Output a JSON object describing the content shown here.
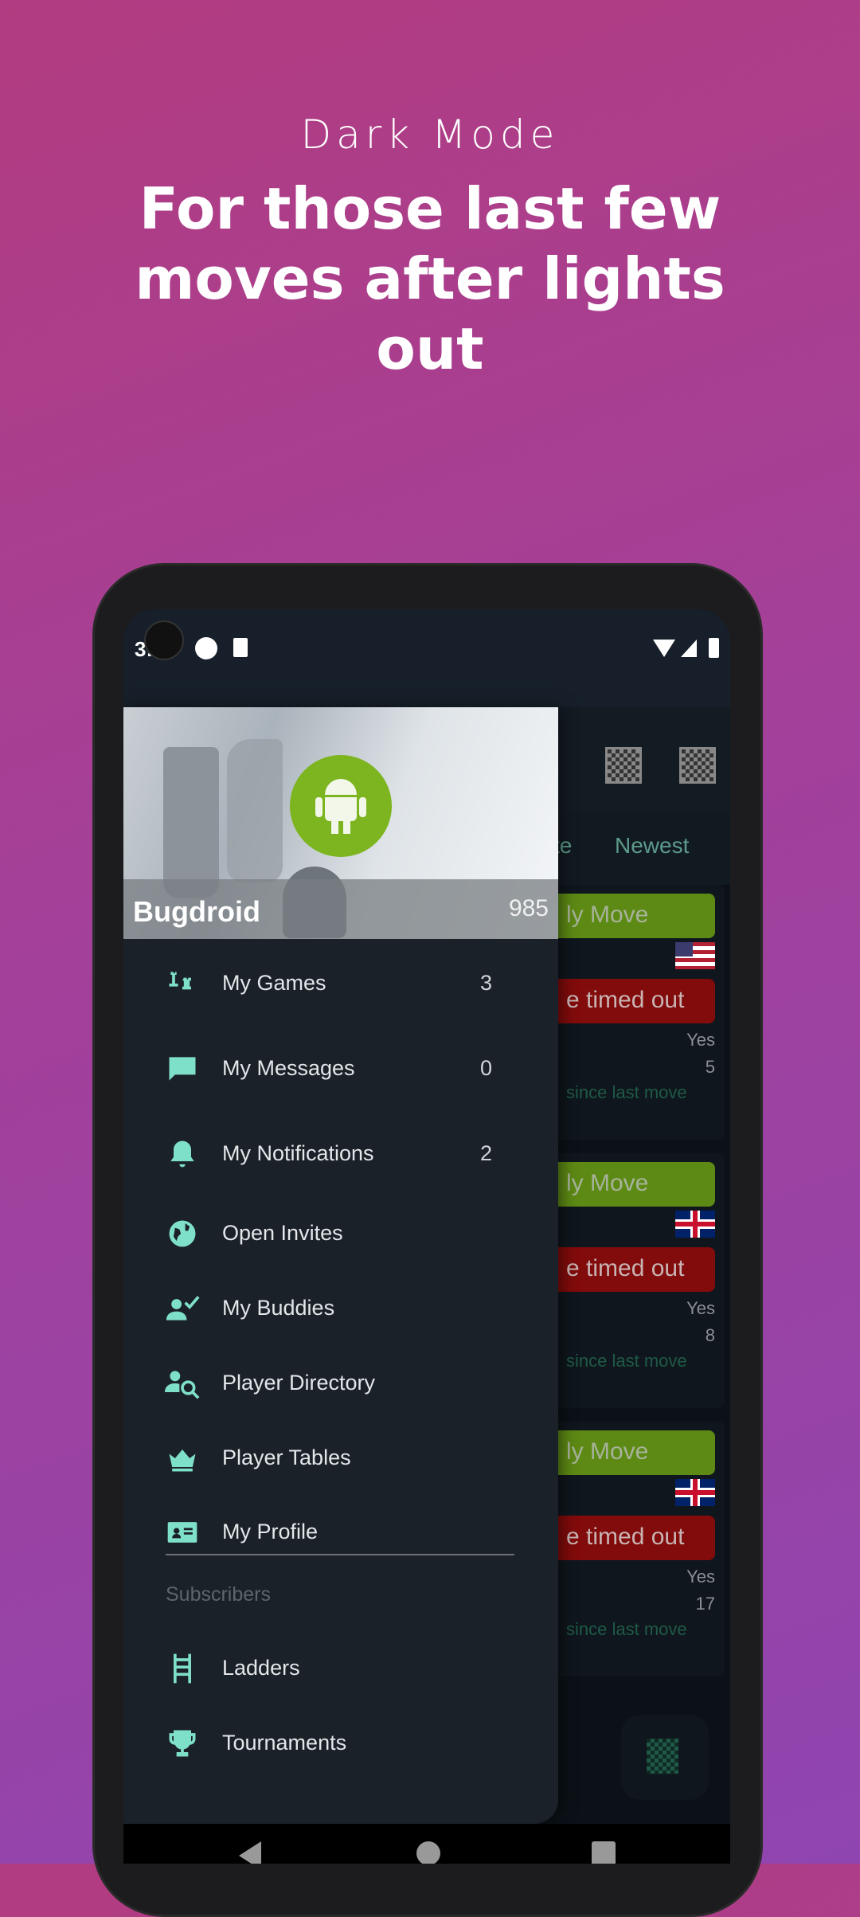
{
  "promo": {
    "subtitle": "Dark Mode",
    "headline": "For those last few moves after lights out"
  },
  "status_bar": {
    "time": "3:",
    "icons": [
      "camera-icon",
      "notification-icon",
      "sd-card-icon",
      "wifi-icon",
      "signal-icon",
      "battery-icon"
    ]
  },
  "toolbar": {
    "icons": [
      "facebook-board-icon",
      "new-game-icon"
    ]
  },
  "tabs": [
    "te",
    "Newest"
  ],
  "games": [
    {
      "action": "ly Move",
      "status": "e timed out",
      "flag": "US",
      "yes": "Yes",
      "count": "5",
      "since": "since last move"
    },
    {
      "action": "ly Move",
      "status": "e timed out",
      "flag": "UK",
      "yes": "Yes",
      "count": "8",
      "since": "since last move"
    },
    {
      "action": "ly Move",
      "status": "e timed out",
      "flag": "UK",
      "yes": "Yes",
      "count": "17",
      "since": "since last move"
    }
  ],
  "drawer": {
    "user": {
      "name": "Bugdroid",
      "rating": "985"
    },
    "items": [
      {
        "label": "My Games",
        "count": "3",
        "icon": "chess-pieces-icon"
      },
      {
        "label": "My Messages",
        "count": "0",
        "icon": "message-icon"
      },
      {
        "label": "My Notifications",
        "count": "2",
        "icon": "bell-icon"
      },
      {
        "label": "Open Invites",
        "icon": "globe-icon"
      },
      {
        "label": "My Buddies",
        "icon": "person-check-icon"
      },
      {
        "label": "Player Directory",
        "icon": "person-search-icon"
      },
      {
        "label": "Player Tables",
        "icon": "crown-icon"
      },
      {
        "label": "My Profile",
        "icon": "id-card-icon"
      }
    ],
    "section": "Subscribers",
    "sub_items": [
      {
        "label": "Ladders",
        "icon": "ladder-icon"
      },
      {
        "label": "Tournaments",
        "icon": "trophy-icon"
      }
    ]
  },
  "colors": {
    "accent": "#7fe0c8",
    "drawer_bg": "#1a2128",
    "green": "#5d8a14",
    "red": "#820b0b"
  }
}
